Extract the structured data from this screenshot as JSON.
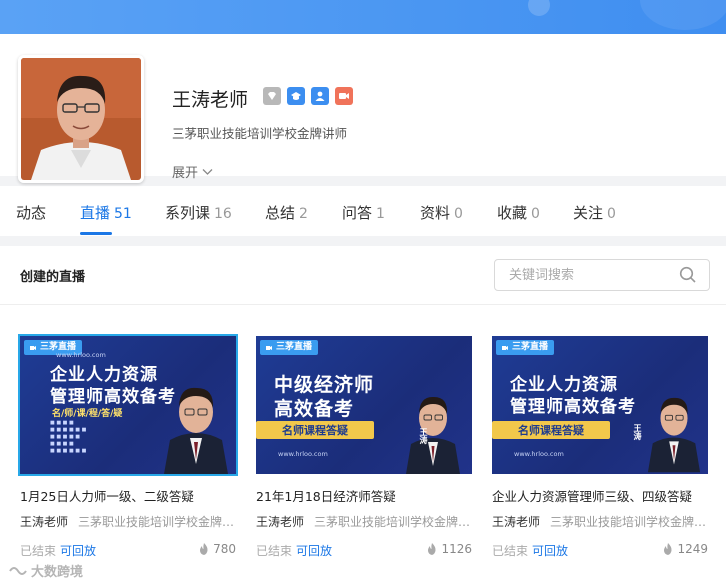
{
  "profile": {
    "name": "王涛老师",
    "subtitle": "三茅职业技能培训学校金牌讲师",
    "expand_label": "展开",
    "badge_colors": [
      "#b8b8b8",
      "#3c8ef0",
      "#3c8ef0",
      "#f0735a"
    ]
  },
  "tabs": [
    {
      "label": "动态",
      "count": ""
    },
    {
      "label": "直播",
      "count": "51"
    },
    {
      "label": "系列课",
      "count": "16"
    },
    {
      "label": "总结",
      "count": "2"
    },
    {
      "label": "问答",
      "count": "1"
    },
    {
      "label": "资料",
      "count": "0"
    },
    {
      "label": "收藏",
      "count": "0"
    },
    {
      "label": "关注",
      "count": "0"
    }
  ],
  "active_tab": "直播",
  "section": {
    "title": "创建的直播",
    "search_placeholder": "关键词搜索"
  },
  "cards": [
    {
      "tag": "三茅直播",
      "url": "www.hrloo.com",
      "poster_line1": "企业人力资源",
      "poster_line2": "管理师高效备考",
      "poster_sub": "名/师/课/程/答/疑",
      "title": "1月25日人力师一级、二级答疑",
      "teacher": "王涛老师",
      "school": "三茅职业技能培训学校金牌讲师",
      "status": "已结束",
      "replay": "可回放",
      "views": "780"
    },
    {
      "tag": "三茅直播",
      "url": "www.hrloo.com",
      "poster_line1": "中级经济师",
      "poster_line2": "高效备考",
      "poster_sub": "名师课程答疑",
      "poster_name": "王涛",
      "title": "21年1月18日经济师答疑",
      "teacher": "王涛老师",
      "school": "三茅职业技能培训学校金牌讲师",
      "status": "已结束",
      "replay": "可回放",
      "views": "1126"
    },
    {
      "tag": "三茅直播",
      "url": "www.hrloo.com",
      "poster_line1": "企业人力资源",
      "poster_line2": "管理师高效备考",
      "poster_sub": "名师课程答疑",
      "poster_name": "王涛",
      "title": "企业人力资源管理师三级、四级答疑",
      "teacher": "王涛老师",
      "school": "三茅职业技能培训学校金牌讲师",
      "status": "已结束",
      "replay": "可回放",
      "views": "1249"
    }
  ],
  "watermark": "大数跨境"
}
